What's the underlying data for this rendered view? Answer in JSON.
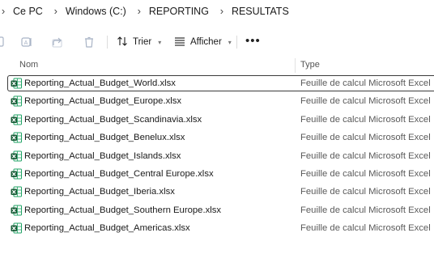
{
  "breadcrumb": {
    "items": [
      "Ce PC",
      "Windows (C:)",
      "REPORTING",
      "RESULTATS"
    ]
  },
  "toolbar": {
    "sort_label": "Trier",
    "view_label": "Afficher",
    "more_label": "•••"
  },
  "columns": {
    "name": "Nom",
    "type": "Type"
  },
  "files": [
    {
      "name": "Reporting_Actual_Budget_World.xlsx",
      "type": "Feuille de calcul Microsoft Excel"
    },
    {
      "name": "Reporting_Actual_Budget_Europe.xlsx",
      "type": "Feuille de calcul Microsoft Excel"
    },
    {
      "name": "Reporting_Actual_Budget_Scandinavia.xlsx",
      "type": "Feuille de calcul Microsoft Excel"
    },
    {
      "name": "Reporting_Actual_Budget_Benelux.xlsx",
      "type": "Feuille de calcul Microsoft Excel"
    },
    {
      "name": "Reporting_Actual_Budget_Islands.xlsx",
      "type": "Feuille de calcul Microsoft Excel"
    },
    {
      "name": "Reporting_Actual_Budget_Central Europe.xlsx",
      "type": "Feuille de calcul Microsoft Excel"
    },
    {
      "name": "Reporting_Actual_Budget_Iberia.xlsx",
      "type": "Feuille de calcul Microsoft Excel"
    },
    {
      "name": "Reporting_Actual_Budget_Southern Europe.xlsx",
      "type": "Feuille de calcul Microsoft Excel"
    },
    {
      "name": "Reporting_Actual_Budget_Americas.xlsx",
      "type": "Feuille de calcul Microsoft Excel"
    }
  ],
  "colors": {
    "excel_green": "#1d6f42",
    "excel_dark": "#185c37",
    "toolbar_disabled": "#a9b4c6"
  }
}
